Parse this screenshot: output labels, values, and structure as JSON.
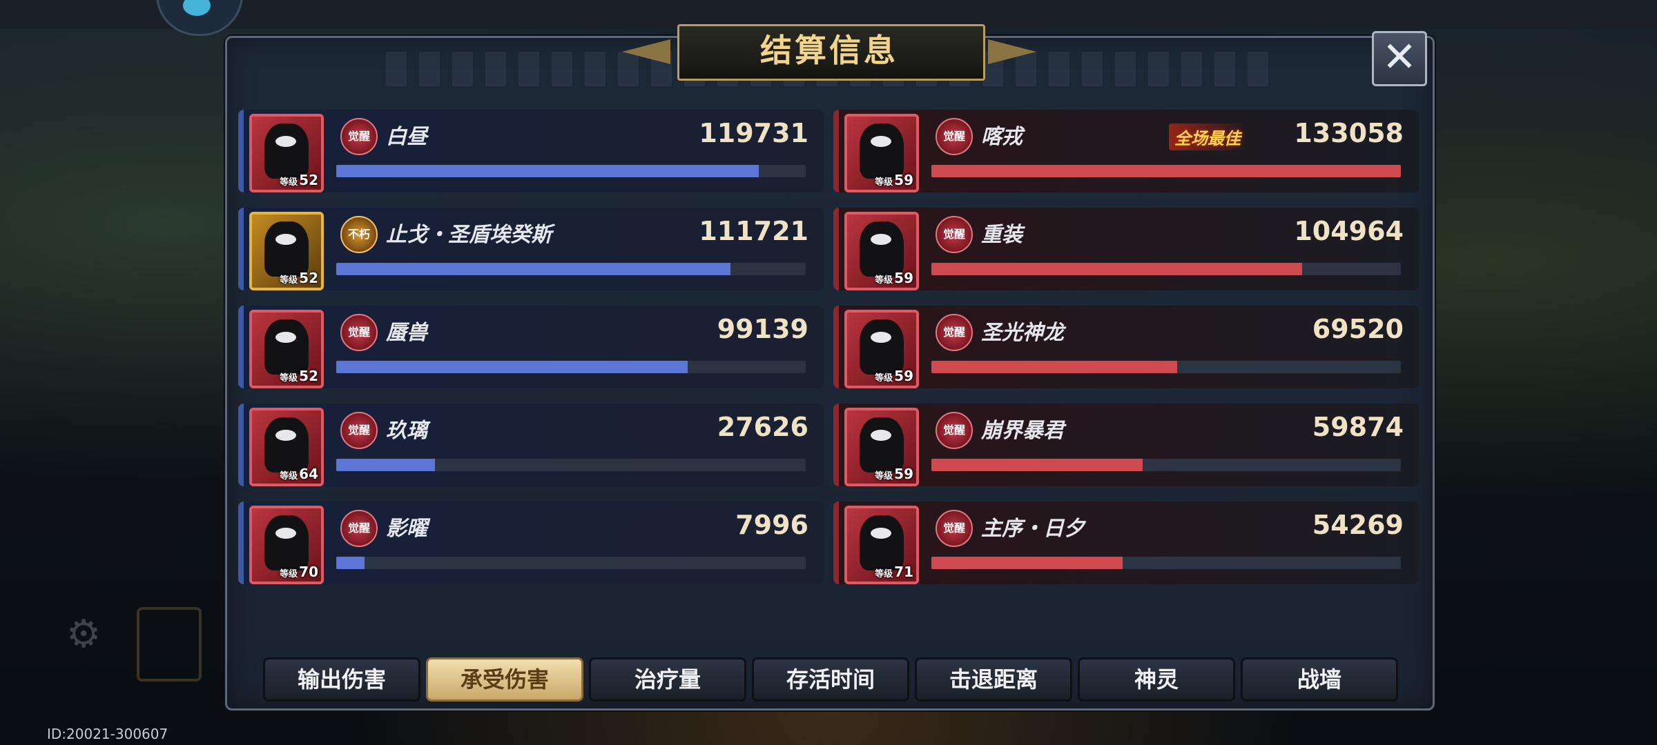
{
  "title": "结算信息",
  "close_icon": "close-icon",
  "id_text": "ID:20021-300607",
  "tabs": [
    {
      "label": "输出伤害",
      "active": false
    },
    {
      "label": "承受伤害",
      "active": true
    },
    {
      "label": "治疗量",
      "active": false
    },
    {
      "label": "存活时间",
      "active": false
    },
    {
      "label": "击退距离",
      "active": false
    },
    {
      "label": "神灵",
      "active": false
    },
    {
      "label": "战墙",
      "active": false
    }
  ],
  "left_team": [
    {
      "name": "白昼",
      "level_label": "等级",
      "level": "52",
      "badge": "觉醒",
      "value": "119731",
      "fill": 0.9
    },
    {
      "name": "止戈・圣盾埃癸斯",
      "level_label": "等级",
      "level": "52",
      "badge": "不朽",
      "value": "111721",
      "fill": 0.84
    },
    {
      "name": "蜃兽",
      "level_label": "等级",
      "level": "52",
      "badge": "觉醒",
      "value": "99139",
      "fill": 0.748
    },
    {
      "name": "玖璃",
      "level_label": "等级",
      "level": "64",
      "badge": "觉醒",
      "value": "27626",
      "fill": 0.21
    },
    {
      "name": "影曜",
      "level_label": "等级",
      "level": "70",
      "badge": "觉醒",
      "value": "7996",
      "fill": 0.06
    }
  ],
  "right_team": [
    {
      "name": "喀戎",
      "level_label": "等级",
      "level": "59",
      "badge": "觉醒",
      "value": "133058",
      "fill": 1.0,
      "best_tag": "全场最佳"
    },
    {
      "name": "重装",
      "level_label": "等级",
      "level": "59",
      "badge": "觉醒",
      "value": "104964",
      "fill": 0.79
    },
    {
      "name": "圣光神龙",
      "level_label": "等级",
      "level": "59",
      "badge": "觉醒",
      "value": "69520",
      "fill": 0.523
    },
    {
      "name": "崩界暴君",
      "level_label": "等级",
      "level": "59",
      "badge": "觉醒",
      "value": "59874",
      "fill": 0.45
    },
    {
      "name": "主序・日夕",
      "level_label": "等级",
      "level": "71",
      "badge": "觉醒",
      "value": "54269",
      "fill": 0.408
    }
  ],
  "colors": {
    "left_bar": "#5c76d6",
    "right_bar": "#cf4a4e",
    "title_gold": "#f2d48a",
    "active_tab": "#e8d09a"
  }
}
